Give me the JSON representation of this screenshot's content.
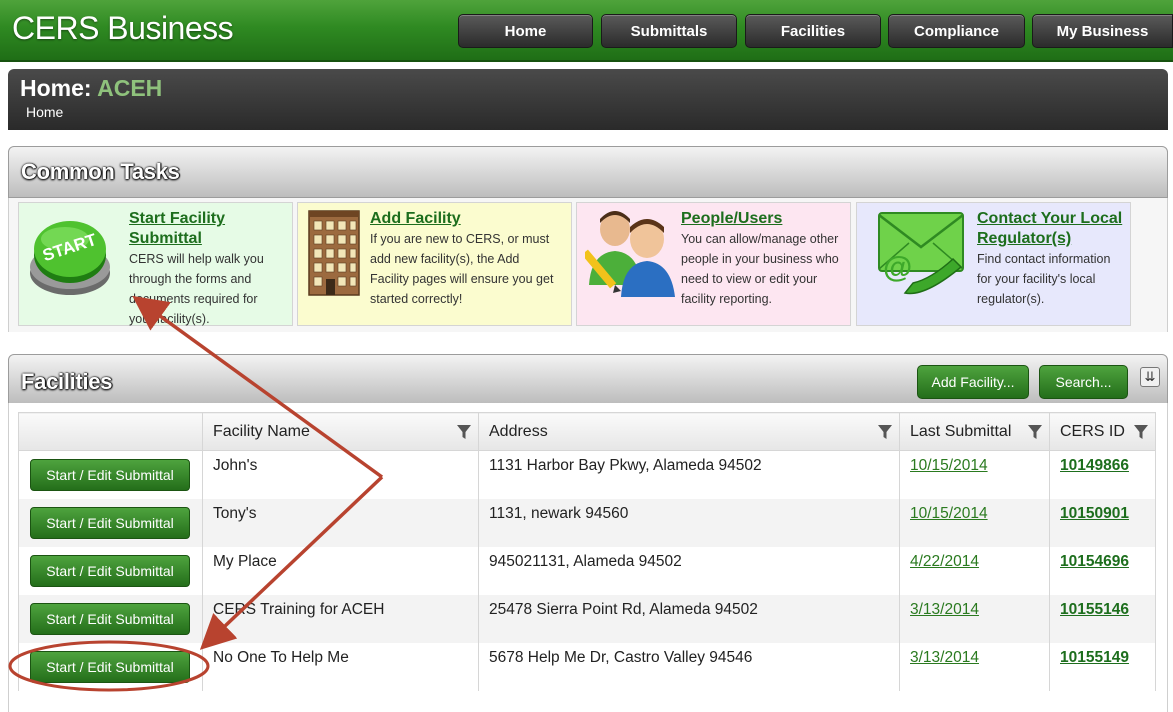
{
  "app": {
    "logo": "CERS Business"
  },
  "nav": {
    "items": [
      {
        "label": "Home"
      },
      {
        "label": "Submittals"
      },
      {
        "label": "Facilities"
      },
      {
        "label": "Compliance"
      },
      {
        "label": "My Business"
      }
    ]
  },
  "page": {
    "title_prefix": "Home:",
    "org": "ACEH",
    "breadcrumb": "Home"
  },
  "common_tasks": {
    "title": "Common Tasks",
    "tasks": [
      {
        "title_line1": "Start Facility",
        "title_line2": "Submittal",
        "icon_label": "START",
        "desc_lines": [
          "CERS will help walk you",
          "through the forms and",
          "documents required for",
          "your facility(s)."
        ],
        "bg": "#e6fbe6"
      },
      {
        "title_line1": "Add Facility",
        "title_line2": "",
        "desc_lines": [
          "If you are new to CERS, or must",
          "add new facility(s), the Add",
          "Facility pages will ensure you get",
          "started correctly!"
        ],
        "bg": "#fbfccf"
      },
      {
        "title_line1": "People/Users",
        "title_line2": "",
        "desc_lines": [
          "You can allow/manage other",
          "people in your business who",
          "need to view or edit your",
          "facility reporting."
        ],
        "bg": "#fde6f1"
      },
      {
        "title_line1": "Contact Your Local",
        "title_line2": "Regulator(s)",
        "desc_lines": [
          "Find contact information",
          "for your facility's local",
          "regulator(s)."
        ],
        "bg": "#e7e8fc"
      }
    ]
  },
  "facilities": {
    "title": "Facilities",
    "add_label": "Add Facility...",
    "search_label": "Search...",
    "columns": [
      "",
      "Facility Name",
      "Address",
      "Last Submittal",
      "CERS ID"
    ],
    "row_button": "Start / Edit Submittal",
    "rows": [
      {
        "name": "John's",
        "address": "1131 Harbor Bay Pkwy, Alameda 94502",
        "last": "10/15/2014",
        "id": "10149866"
      },
      {
        "name": "Tony's",
        "address": "1131, newark 94560",
        "last": "10/15/2014",
        "id": "10150901"
      },
      {
        "name": "My Place",
        "address": "945021131, Alameda 94502",
        "last": "4/22/2014",
        "id": "10154696"
      },
      {
        "name": "CERS Training for ACEH",
        "address": "25478 Sierra Point Rd, Alameda 94502",
        "last": "3/13/2014",
        "id": "10155146"
      },
      {
        "name": "No One To Help Me",
        "address": "5678 Help Me Dr, Castro Valley 94546",
        "last": "3/13/2014",
        "id": "10155149"
      }
    ]
  },
  "colors": {
    "header_green": "#2f8a22",
    "link_green": "#1d6e1d",
    "annotation_red": "#b8432f"
  }
}
